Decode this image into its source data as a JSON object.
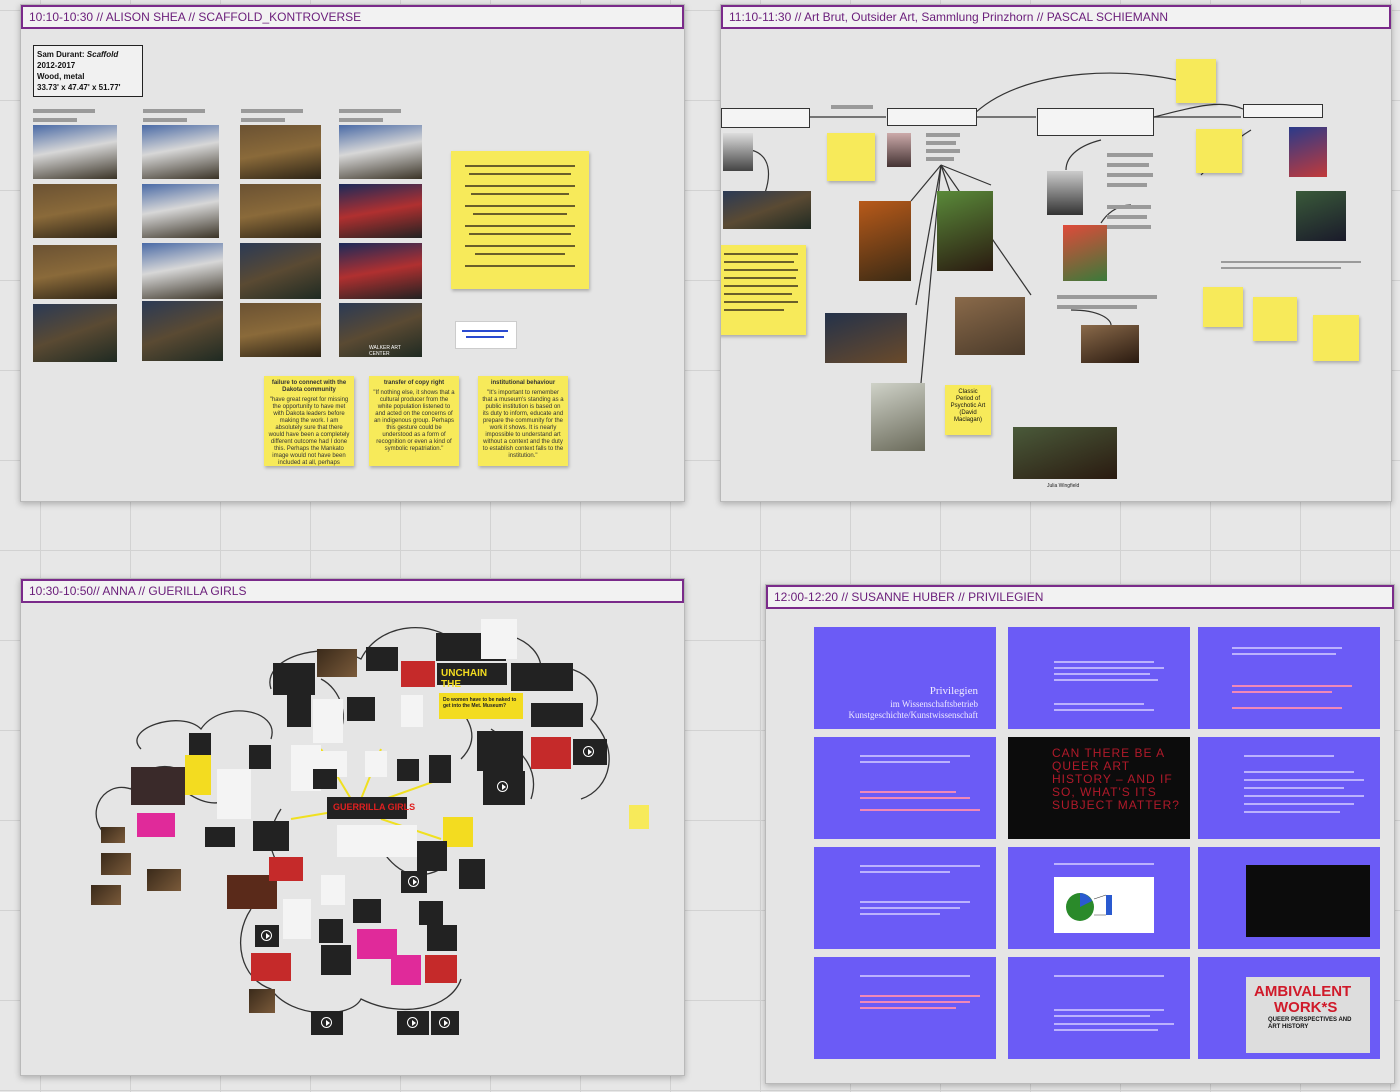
{
  "frames": {
    "shea": {
      "title": "10:10-10:30 // ALISON SHEA // SCAFFOLD_KONTROVERSE",
      "caption": {
        "artist": "Sam Durant: ",
        "work": "Scaffold",
        "years": "2012-2017",
        "material": "Wood, metal",
        "dims": "33.73' x 47.47' x 51.77'"
      },
      "notes": [
        {
          "heading": "failure to connect with the Dakota community",
          "body": "\"have great regret for missing the opportunity to have met with Dakota leaders before making the work. I am absolutely sure that there would have been a completely different outcome had I done this. Perhaps the Mankato image would not have been included at all, perhaps Dakota leadership would have been amenable to including it in some other manner.\""
        },
        {
          "heading": "transfer of copy right",
          "body": "\"If nothing else, it shows that a cultural producer from the white population listened to and acted on the concerns of an indigenous group. Perhaps this gesture could be understood as a form of recognition or even a kind of symbolic repatriation.\""
        },
        {
          "heading": "institutional behaviour",
          "body": "\"It's important to remember that a museum's standing as a public institution is based on its duty to inform, educate and prepare the community for the work it shows. It is nearly impossible to understand art without a context and the duty to establish context falls to the institution.\""
        }
      ],
      "photo_label": "WALKER ART CENTER"
    },
    "schiemann": {
      "title": "11:10-11:30 // Art Brut, Outsider Art, Sammlung Prinzhorn // PASCAL SCHIEMANN",
      "sticky_psychotic": "Classic Period of Psychotic Art (David Maclagan)",
      "photo_caption": "Julia Wingfield"
    },
    "anna": {
      "title": "10:30-10:50// ANNA // GUERILLA GIRLS",
      "banner_unchain": "UNCHAIN THE",
      "banner_question": "Do women have to be naked to get into the Met. Museum?",
      "logo": "GUERRILLA GIRLS"
    },
    "huber": {
      "title": "12:00-12:20 // SUSANNE HUBER // PRIVILEGIEN",
      "slide_title": "Privilegien",
      "slide_sub1": "im Wissenschaftsbetrieb",
      "slide_sub2": "Kunstgeschichte/Kunstwissenschaft",
      "dark_slide_text": "CAN THERE BE A QUEER ART HISTORY – AND IF SO, WHAT'S ITS SUBJECT MATTER?",
      "ambivalent_1": "AMBIVALENT",
      "ambivalent_2": "WORK*S",
      "ambivalent_3": "QUEER PERSPECTIVES AND ART HISTORY"
    }
  },
  "colors": {
    "frame_title": "#6a1d7a",
    "sticky": "#f7ea5a",
    "slide": "#6b5bf6"
  }
}
